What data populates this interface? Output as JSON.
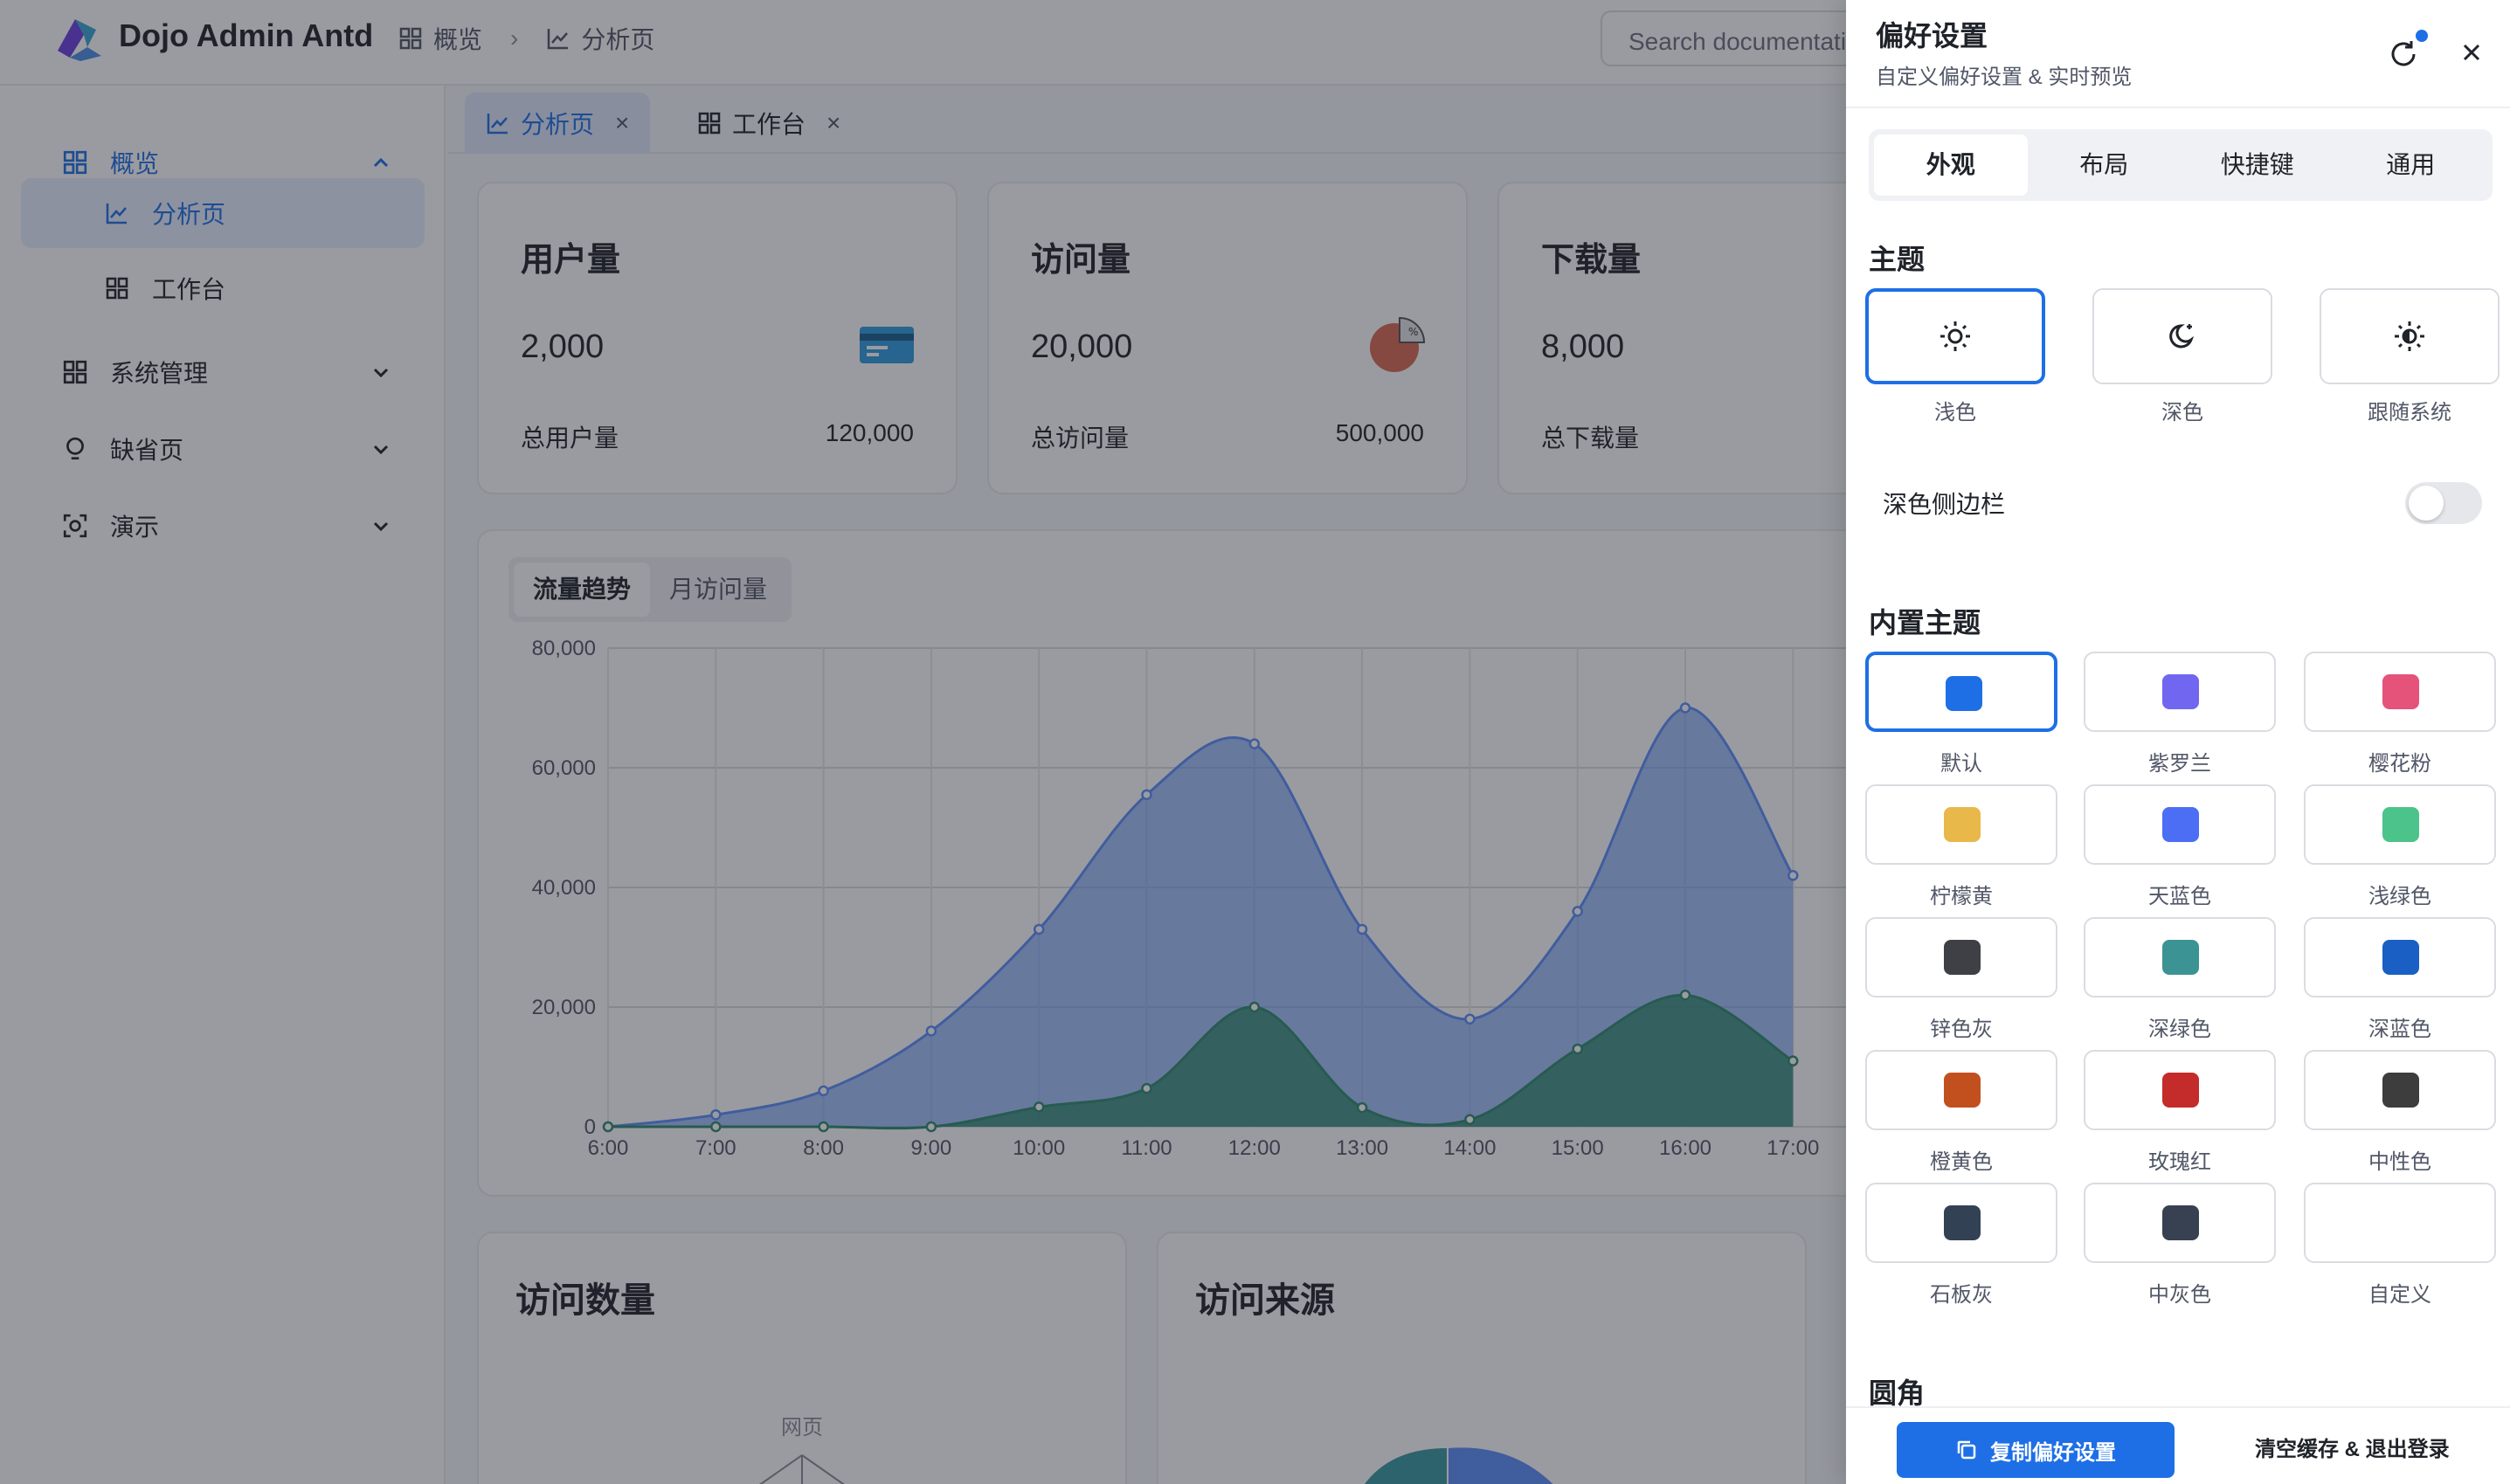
{
  "header": {
    "brand": "Dojo Admin Antd",
    "breadcrumb": [
      "概览",
      "分析页"
    ],
    "search_placeholder": "Search documentation"
  },
  "sidebar": {
    "items": [
      {
        "label": "概览",
        "icon": "grid-icon",
        "expanded": true
      },
      {
        "label": "分析页",
        "icon": "line-chart-icon",
        "active": true
      },
      {
        "label": "工作台",
        "icon": "grid-icon"
      },
      {
        "label": "系统管理",
        "icon": "grid-icon"
      },
      {
        "label": "缺省页",
        "icon": "bulb-icon"
      },
      {
        "label": "演示",
        "icon": "scan-icon"
      }
    ],
    "collapse_glyph": "«"
  },
  "tabs": [
    {
      "label": "分析页",
      "icon": "line-chart-icon",
      "active": true
    },
    {
      "label": "工作台",
      "icon": "grid-icon",
      "active": false
    }
  ],
  "kpis": [
    {
      "title": "用户量",
      "value": "2,000",
      "foot": "总用户量",
      "total": "120,000",
      "icon": "card-icon"
    },
    {
      "title": "访问量",
      "value": "20,000",
      "foot": "总访问量",
      "total": "500,000",
      "icon": "pie-icon"
    },
    {
      "title": "下载量",
      "value": "8,000",
      "foot": "总下载量",
      "total": "",
      "icon": ""
    }
  ],
  "trend": {
    "tabs": [
      "流量趋势",
      "月访问量"
    ]
  },
  "chart_data": {
    "type": "area",
    "x": [
      "6:00",
      "7:00",
      "8:00",
      "9:00",
      "10:00",
      "11:00",
      "12:00",
      "13:00",
      "14:00",
      "15:00",
      "16:00",
      "17:00"
    ],
    "series": [
      {
        "values": [
          0,
          2000,
          6000,
          16000,
          33000,
          55500,
          64000,
          33000,
          18000,
          36000,
          70000,
          42000
        ],
        "color": "#5b8ff9"
      },
      {
        "values": [
          0,
          0,
          0,
          0,
          3300,
          6400,
          20000,
          3200,
          1200,
          13000,
          22000,
          11000
        ],
        "color": "#2e8a6e"
      }
    ],
    "ylim": [
      0,
      80000
    ],
    "yticks": [
      "80,000",
      "60,000",
      "40,000",
      "20,000",
      "0"
    ],
    "grid": true
  },
  "bottom_cards": [
    {
      "title": "访问数量",
      "label": "网页"
    },
    {
      "title": "访问来源"
    }
  ],
  "drawer": {
    "title": "偏好设置",
    "subtitle": "自定义偏好设置 & 实时预览",
    "tabs": [
      "外观",
      "布局",
      "快捷键",
      "通用"
    ],
    "theme_heading": "主题",
    "themes": [
      {
        "label": "浅色",
        "icon": "sun-icon",
        "selected": true
      },
      {
        "label": "深色",
        "icon": "moon-icon",
        "selected": false
      },
      {
        "label": "跟随系统",
        "icon": "sun-moon-icon",
        "selected": false
      }
    ],
    "dark_sidebar_label": "深色侧边栏",
    "dark_sidebar_on": false,
    "builtin_heading": "内置主题",
    "builtin": [
      {
        "label": "默认",
        "color": "#1e6fe6",
        "selected": true
      },
      {
        "label": "紫罗兰",
        "color": "#7166f0"
      },
      {
        "label": "樱花粉",
        "color": "#e5527a"
      },
      {
        "label": "柠檬黄",
        "color": "#e8b84a"
      },
      {
        "label": "天蓝色",
        "color": "#4c6ef5"
      },
      {
        "label": "浅绿色",
        "color": "#4cc38a"
      },
      {
        "label": "锌色灰",
        "color": "#3f3f46"
      },
      {
        "label": "深绿色",
        "color": "#3b9393"
      },
      {
        "label": "深蓝色",
        "color": "#1a5fc4"
      },
      {
        "label": "橙黄色",
        "color": "#c2501e"
      },
      {
        "label": "玫瑰红",
        "color": "#c42b2b"
      },
      {
        "label": "中性色",
        "color": "#3d3d3d"
      },
      {
        "label": "石板灰",
        "color": "#334155"
      },
      {
        "label": "中灰色",
        "color": "#374151"
      },
      {
        "label": "自定义",
        "color": ""
      }
    ],
    "radius_heading": "圆角",
    "copy_button": "复制偏好设置",
    "clear_button": "清空缓存 & 退出登录"
  }
}
